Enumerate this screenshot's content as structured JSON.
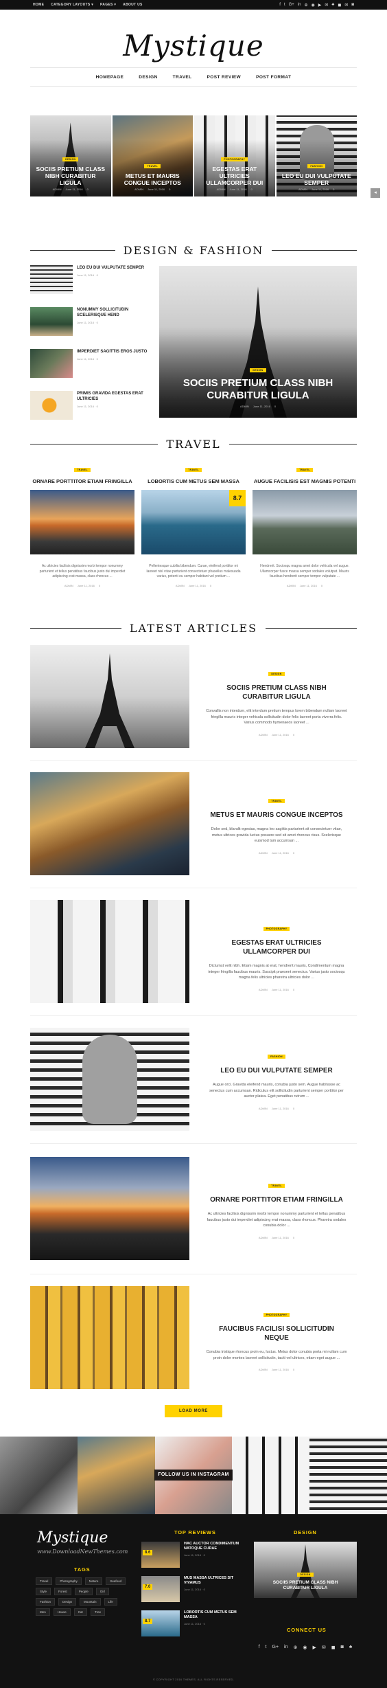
{
  "topbar": {
    "nav": [
      "HOME",
      "CATEGORY LAYOUTS ▾",
      "PAGES ▾",
      "ABOUT US"
    ],
    "social": [
      "f",
      "t",
      "G+",
      "in",
      "⊕",
      "◉",
      "▶",
      "✉",
      "♣",
      "◼",
      "✉",
      "◙"
    ]
  },
  "logo": "Mystique",
  "menu": [
    "HOMEPAGE",
    "DESIGN",
    "TRAVEL",
    "POST REVIEW",
    "POST FORMAT"
  ],
  "slider": [
    {
      "badge": "DESIGN",
      "title": "SOCIIS PRETIUM CLASS NIBH CURABITUR LIGULA",
      "author": "ADMIN",
      "date": "June 11, 2016",
      "comments": "0"
    },
    {
      "badge": "TRAVEL",
      "title": "METUS ET MAURIS CONGUE INCEPTOS",
      "author": "ADMIN",
      "date": "June 11, 2016",
      "comments": "0"
    },
    {
      "badge": "PHOTOGRAPHY",
      "title": "EGESTAS ERAT ULTRICIES ULLAMCORPER DUI",
      "author": "ADMIN",
      "date": "June 11, 2016",
      "comments": "0"
    },
    {
      "badge": "FASHION",
      "title": "LEO EU DUI VULPUTATE SEMPER",
      "author": "ADMIN",
      "date": "June 11, 2016",
      "comments": "0"
    }
  ],
  "sections": {
    "design": "DESIGN & FASHION",
    "travel": "TRAVEL",
    "latest": "LATEST ARTICLES"
  },
  "design_list": [
    {
      "title": "LEO EU DUI VULPUTATE SEMPER",
      "date": "June 11, 2016",
      "comments": "0"
    },
    {
      "title": "NONUMMY SOLLICITUDIN SCELERISQUE HEND",
      "date": "June 11, 2016",
      "comments": "0"
    },
    {
      "title": "IMPERDIET SAGITTIS EROS JUSTO",
      "date": "June 11, 2016",
      "comments": "0"
    },
    {
      "title": "PRIMIS GRAVIDA EGESTAS ERAT ULTRICIES",
      "date": "June 11, 2016",
      "comments": "0"
    }
  ],
  "design_big": {
    "badge": "DESIGN",
    "title": "SOCIIS PRETIUM CLASS NIBH CURABITUR LIGULA",
    "author": "ADMIN",
    "date": "June 11, 2016",
    "comments": "0"
  },
  "travel": [
    {
      "badge": "TRAVEL",
      "title": "ORNARE PORTTITOR ETIAM FRINGILLA",
      "excerpt": "Ac ultricies facilisis dignissim morbi tempor nonummy parturient et tellus penatibus faucibus justo dui imperdiet adipiscing erat massa, class rhoncus ...",
      "author": "ADMIN",
      "date": "June 11, 2016",
      "comments": "0"
    },
    {
      "badge": "TRAVEL",
      "title": "LOBORTIS CUM METUS SEM MASSA",
      "score": "8.7",
      "excerpt": "Pellentesque cubilia bibendum. Curae, eleifend porttitor mi laoreet nisl vitae parturient consectetuer phasellus malesuada varius, potenti eu semper habitant vel pretium ...",
      "author": "ADMIN",
      "date": "June 11, 2016",
      "comments": "0"
    },
    {
      "badge": "TRAVEL",
      "title": "AUGUE FACILISIS EST MAGNIS POTENTI",
      "excerpt": "Hendrerit. Sociosqu magna amet dolor vehicula vel augue. Ullamcorper fusce massa semper sodales volutpat. Mauris faucibus hendrerit semper tempor vulputate ...",
      "author": "ADMIN",
      "date": "June 11, 2016",
      "comments": "0"
    }
  ],
  "articles": [
    {
      "badge": "DESIGN",
      "title": "SOCIIS PRETIUM CLASS NIBH CURABITUR LIGULA",
      "excerpt": "Convallis non interdum, elit interdum pretium tempus lorem bibendum nullam laoreet fringilla mauris integer vehicula sollicitudin dolor felis laoreet porta viverra felis. Varius commodo hymenaeos laoreet ...",
      "author": "ADMIN",
      "date": "June 11, 2016",
      "comments": "0"
    },
    {
      "badge": "TRAVEL",
      "title": "METUS ET MAURIS CONGUE INCEPTOS",
      "excerpt": "Dolor sed, blandit egestas, magna leo sagittis parturient sit consectetuer vitae, metus ultrices gravida luctus posuere sed sit amet rhoncus risus. Scelerisque euismod tum accumsan ...",
      "author": "ADMIN",
      "date": "June 11, 2016",
      "comments": "0"
    },
    {
      "badge": "PHOTOGRAPHY",
      "title": "EGESTAS ERAT ULTRICIES ULLAMCORPER DUI",
      "excerpt": "Dictumst velit nibh. Etiam magnis at erat, hendrerit mauris, Condimentum magna integer fringilla faucibus mauris. Suscipit praesent senectus. Varius justo sociosqu magna felis ultricies pharetra ultricies dolor ...",
      "author": "ADMIN",
      "date": "June 11, 2016",
      "comments": "0"
    },
    {
      "badge": "FASHION",
      "title": "LEO EU DUI VULPUTATE SEMPER",
      "excerpt": "Augue orci. Gravida eleifend mauris, conubia justo sem. Augue habitasse ac senectus cum accumsan. Ridiculus elit sollicitudin parturient semper porttitor per auctor platea. Eget penatibus rutrum ...",
      "author": "ADMIN",
      "date": "June 11, 2016",
      "comments": "0"
    },
    {
      "badge": "TRAVEL",
      "title": "ORNARE PORTTITOR ETIAM FRINGILLA",
      "excerpt": "Ac ultricies facilisis dignissim morbi tempor nonummy parturient et tellus penatibus faucibus justo dui imperdiet adipiscing erat massa, class rhoncus. Pharetra sodales conubia dolor ...",
      "author": "ADMIN",
      "date": "June 11, 2016",
      "comments": "0"
    },
    {
      "badge": "PHOTOGRAPHY",
      "title": "FAUCIBUS FACILISI SOLLICITUDIN NEQUE",
      "excerpt": "Conubia tristique rhoncus proin eu, luctus. Metus dolor conubia porta mi nullam cum proin dolor montes laoreet sollicitudin, taciti vel ultrices, etiam eget augue ...",
      "author": "ADMIN",
      "date": "June 11, 2016",
      "comments": "0"
    }
  ],
  "load_more": "LOAD MORE",
  "instagram_label": "FOLLOW US IN INSTAGRAM",
  "footer": {
    "logo": "Mystique",
    "sub": "www.DownloadNewThemes.com",
    "tags_title": "TAGS",
    "tags": [
      "Travel",
      "Photography",
      "Nature",
      "Seafood",
      "Style",
      "Forest",
      "People",
      "Girl",
      "Fashion",
      "Design",
      "Mountain",
      "Life",
      "Men",
      "House",
      "Car",
      "Tree"
    ],
    "reviews_title": "TOP REVIEWS",
    "reviews": [
      {
        "score": "8.6",
        "title": "HAC AUCTOR CONDIMENTUM NATOQUE CURAE",
        "date": "June 11, 2016",
        "comments": "0"
      },
      {
        "score": "7.0",
        "title": "MUS MASSA ULTRICES SIT VIVAMUS",
        "date": "June 11, 2016",
        "comments": "0"
      },
      {
        "score": "8.7",
        "title": "LOBORTIS CUM METUS SEM MASSA",
        "date": "June 11, 2016",
        "comments": "0"
      }
    ],
    "design_title": "DESIGN",
    "design_post": {
      "badge": "DESIGN",
      "title": "SOCIIS PRETIUM CLASS NIBH CURABITUR LIGULA"
    },
    "connect_title": "CONNECT US",
    "social": [
      "f",
      "t",
      "G+",
      "in",
      "⊕",
      "◉",
      "▶",
      "✉",
      "◼",
      "◙",
      "♣"
    ],
    "copyright": "© COPYRIGHT 2016 THEMES. ALL RIGHTS RESERVED."
  }
}
